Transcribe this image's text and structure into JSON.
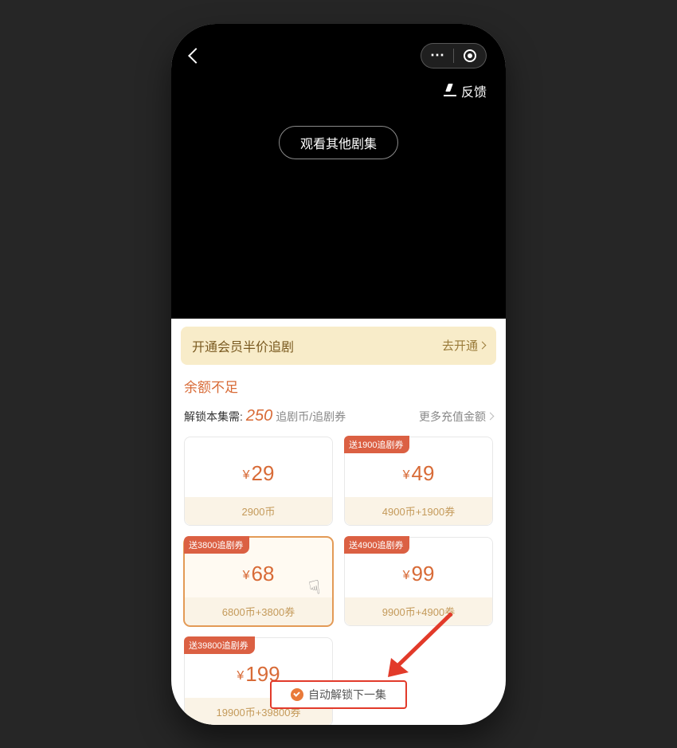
{
  "header": {
    "feedback_label": "反馈",
    "watch_other_label": "观看其他剧集"
  },
  "member_banner": {
    "text": "开通会员半价追剧",
    "action": "去开通"
  },
  "balance": {
    "insufficient_label": "余额不足",
    "unlock_prefix": "解锁本集需:",
    "unlock_amount": "250",
    "unlock_unit": "追剧币/追剧券",
    "more_topup_label": "更多充值金额"
  },
  "tiers": [
    {
      "badge": "",
      "price": "29",
      "benefit": "2900币"
    },
    {
      "badge": "送1900追剧券",
      "price": "49",
      "benefit": "4900币+1900券"
    },
    {
      "badge": "送3800追剧券",
      "price": "68",
      "benefit": "6800币+3800券",
      "selected": true
    },
    {
      "badge": "送4900追剧券",
      "price": "99",
      "benefit": "9900币+4900券"
    },
    {
      "badge": "送39800追剧券",
      "price": "199",
      "benefit": "19900币+39800券"
    }
  ],
  "auto_unlock": {
    "label": "自动解锁下一集",
    "checked": true
  }
}
